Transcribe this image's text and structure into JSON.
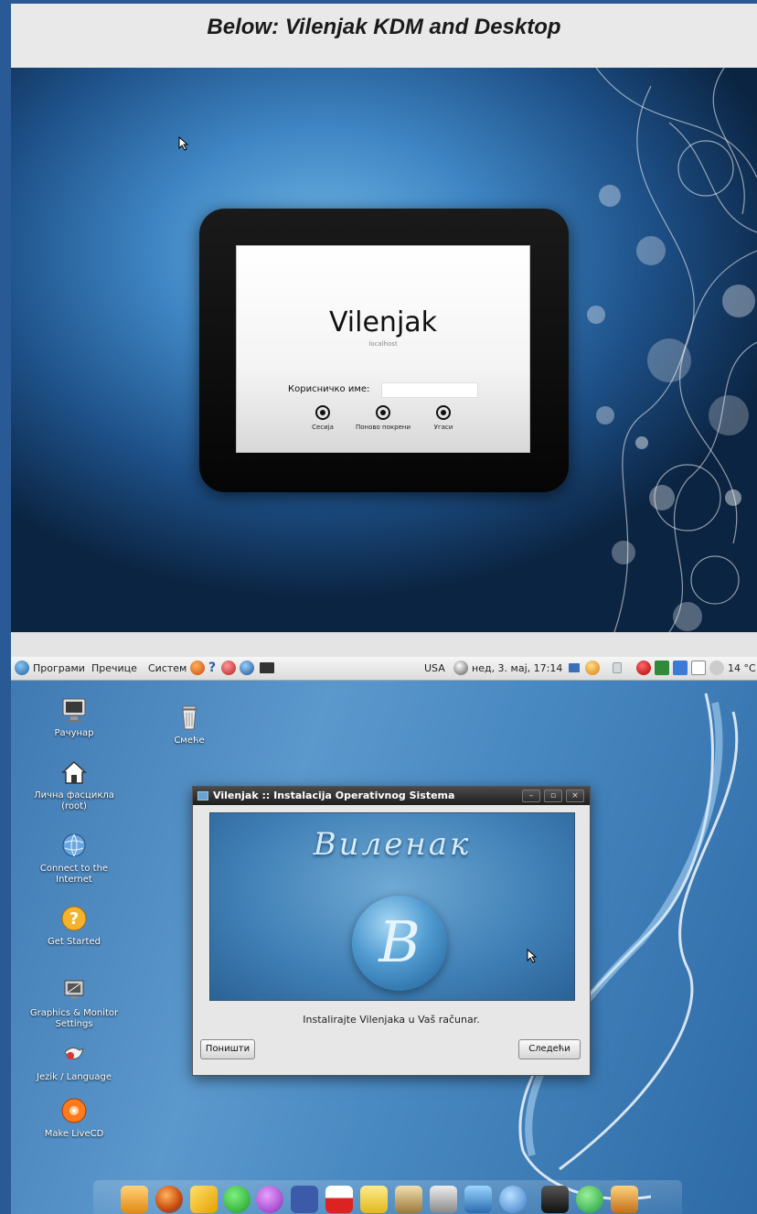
{
  "caption": "Below: Vilenjak KDM and Desktop",
  "kdm": {
    "title": "Vilenjak",
    "host": "localhost",
    "user_label": "Корисничко име:",
    "user_value": "",
    "buttons": [
      {
        "label": "Сесија",
        "icon": "session-icon"
      },
      {
        "label": "Поново покрени",
        "icon": "restart-icon"
      },
      {
        "label": "Угаси",
        "icon": "shutdown-icon"
      }
    ]
  },
  "panel": {
    "menus": [
      "Програми",
      "Пречице",
      "Систем"
    ],
    "keyboard": "USA",
    "clock": "нед, 3. мај, 17:14",
    "temperature": "14 °C"
  },
  "desktop_icons": [
    {
      "label": "Рачунар",
      "icon": "computer-icon"
    },
    {
      "label": "Лична фасцикла (root)",
      "icon": "home-icon"
    },
    {
      "label": "Connect to the Internet",
      "icon": "globe-icon"
    },
    {
      "label": "Get Started",
      "icon": "help-icon"
    },
    {
      "label": "Graphics & Monitor Settings",
      "icon": "monitor-icon"
    },
    {
      "label": "Jezik / Language",
      "icon": "language-icon"
    },
    {
      "label": "Make LiveCD",
      "icon": "cd-icon"
    },
    {
      "label": "Смеће",
      "icon": "trash-icon"
    }
  ],
  "installer": {
    "title": "Vilenjak :: Instalacija Operativnog Sistema",
    "logo_text": "Виленак",
    "logo_letter": "B",
    "message": "Instalirajte Vilenjaka u Vaš računar.",
    "cancel_label": "Поништи",
    "next_label": "Следећи"
  },
  "dock": [
    "files-icon",
    "firefox-icon",
    "mail-icon",
    "skype-icon",
    "pidgin-icon",
    "facebook-icon",
    "youtube-icon",
    "folder-icon",
    "gimp-icon",
    "settings-icon",
    "photos-icon",
    "music-icon",
    "install-icon",
    "media-player-icon",
    "video-icon"
  ],
  "colors": {
    "frame_border": "#2a5a96",
    "kdm_bg": "#1d4f86",
    "desktop_bg": "#4a8ac2",
    "installer_banner": "#3f7fb5"
  }
}
